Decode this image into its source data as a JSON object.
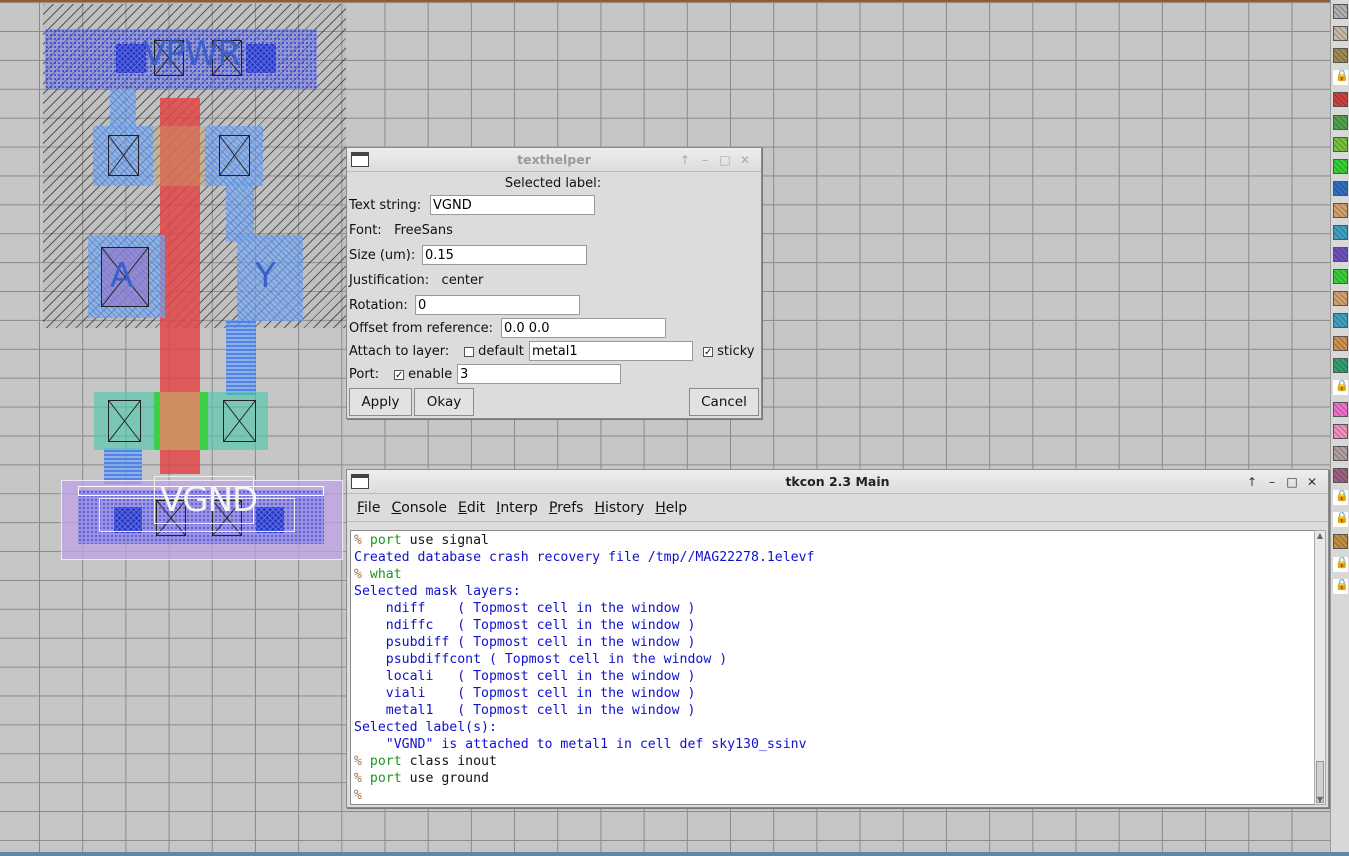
{
  "layout": {
    "labels": {
      "vpwr": "VPWR",
      "a": "A",
      "y": "Y",
      "vgnd": "VGND"
    }
  },
  "texthelper": {
    "title": "texthelper",
    "heading": "Selected label:",
    "text_string_label": "Text string:",
    "text_string_value": "VGND",
    "font_label": "Font:",
    "font_value": "FreeSans",
    "size_label": "Size (um):",
    "size_value": "0.15",
    "justification_label": "Justification:",
    "justification_value": "center",
    "rotation_label": "Rotation:",
    "rotation_value": "0",
    "offset_label": "Offset from reference:",
    "offset_value": "0.0 0.0",
    "attach_label": "Attach to layer:",
    "default_label": "default",
    "default_checked": false,
    "layer_value": "metal1",
    "sticky_label": "sticky",
    "sticky_checked": true,
    "port_label": "Port:",
    "enable_label": "enable",
    "enable_checked": true,
    "port_value": "3",
    "apply": "Apply",
    "okay": "Okay",
    "cancel": "Cancel"
  },
  "tkcon": {
    "title": "tkcon 2.3 Main",
    "menu": [
      "File",
      "Console",
      "Edit",
      "Interp",
      "Prefs",
      "History",
      "Help"
    ],
    "menu_mnemonics": [
      "F",
      "C",
      "E",
      "I",
      "P",
      "H",
      "H"
    ],
    "lines": [
      {
        "prompt": "% ",
        "cmd1": "port",
        "cmd2": " use signal",
        "out": ""
      },
      {
        "prompt": "",
        "cmd1": "",
        "cmd2": "",
        "out": "Created database crash recovery file /tmp//MAG22278.1elevf"
      },
      {
        "prompt": "% ",
        "cmd1": "what",
        "cmd2": "",
        "out": ""
      },
      {
        "prompt": "",
        "cmd1": "",
        "cmd2": "",
        "out": "Selected mask layers:"
      },
      {
        "prompt": "",
        "cmd1": "",
        "cmd2": "",
        "out": "    ndiff    ( Topmost cell in the window )"
      },
      {
        "prompt": "",
        "cmd1": "",
        "cmd2": "",
        "out": "    ndiffc   ( Topmost cell in the window )"
      },
      {
        "prompt": "",
        "cmd1": "",
        "cmd2": "",
        "out": "    psubdiff ( Topmost cell in the window )"
      },
      {
        "prompt": "",
        "cmd1": "",
        "cmd2": "",
        "out": "    psubdiffcont ( Topmost cell in the window )"
      },
      {
        "prompt": "",
        "cmd1": "",
        "cmd2": "",
        "out": "    locali   ( Topmost cell in the window )"
      },
      {
        "prompt": "",
        "cmd1": "",
        "cmd2": "",
        "out": "    viali    ( Topmost cell in the window )"
      },
      {
        "prompt": "",
        "cmd1": "",
        "cmd2": "",
        "out": "    metal1   ( Topmost cell in the window )"
      },
      {
        "prompt": "",
        "cmd1": "",
        "cmd2": "",
        "out": "Selected label(s):"
      },
      {
        "prompt": "",
        "cmd1": "",
        "cmd2": "",
        "out": "    \"VGND\" is attached to metal1 in cell def sky130_ssinv"
      },
      {
        "prompt": "% ",
        "cmd1": "port",
        "cmd2": " class inout",
        "out": ""
      },
      {
        "prompt": "% ",
        "cmd1": "port",
        "cmd2": " use ground",
        "out": ""
      },
      {
        "prompt": "%",
        "cmd1": "",
        "cmd2": "",
        "out": ""
      }
    ]
  },
  "palette": {
    "swatches": [
      "#b0b0b0",
      "#c8b8a8",
      "#a08a50",
      "lock",
      "#d04040",
      "#50a050",
      "#78c040",
      "#38d038",
      "#3070c0",
      "#d0a070",
      "#40a0c0",
      "#7050c0",
      "#38d038",
      "#d0a070",
      "#40a0c0",
      "#d09050",
      "#30a070",
      "lock",
      "#f070d0",
      "#f090c0",
      "#b0a0a0",
      "#a06080",
      "lock",
      "lock",
      "#c09040",
      "lock",
      "lock"
    ]
  },
  "colors": {
    "prompt": "#a07850",
    "command": "#1a9a1a",
    "output": "#1010d0",
    "poly": "#e24646",
    "metal1": "#6e78e6"
  }
}
